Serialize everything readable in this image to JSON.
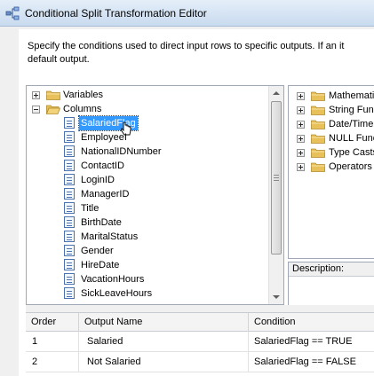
{
  "window": {
    "title": "Conditional Split Transformation Editor",
    "icon": "conditional-split-icon"
  },
  "instructions": {
    "line1": "Specify the conditions used to direct input rows to specific outputs. If an it",
    "line2": "default output."
  },
  "left_tree": {
    "variables_label": "Variables",
    "columns_label": "Columns",
    "columns": [
      "SalariedFlag",
      "EmployeeI",
      "NationalIDNumber",
      "ContactID",
      "LoginID",
      "ManagerID",
      "Title",
      "BirthDate",
      "MaritalStatus",
      "Gender",
      "HireDate",
      "VacationHours",
      "SickLeaveHours"
    ],
    "selected_column": "SalariedFlag"
  },
  "right_tree": {
    "items": [
      "Mathematic",
      "String Func",
      "Date/Time",
      "NULL Func",
      "Type Casts",
      "Operators"
    ]
  },
  "description": {
    "label": "Description:"
  },
  "grid": {
    "headers": {
      "order": "Order",
      "output_name": "Output Name",
      "condition": "Condition"
    },
    "rows": [
      {
        "order": "1",
        "output_name": "Salaried",
        "condition": "SalariedFlag ==  TRUE"
      },
      {
        "order": "2",
        "output_name": "Not Salaried",
        "condition": "SalariedFlag ==  FALSE"
      }
    ]
  },
  "colors": {
    "selection": "#3399ff",
    "folder": "#e8c15a",
    "titlebar": "#dbe6f4"
  }
}
